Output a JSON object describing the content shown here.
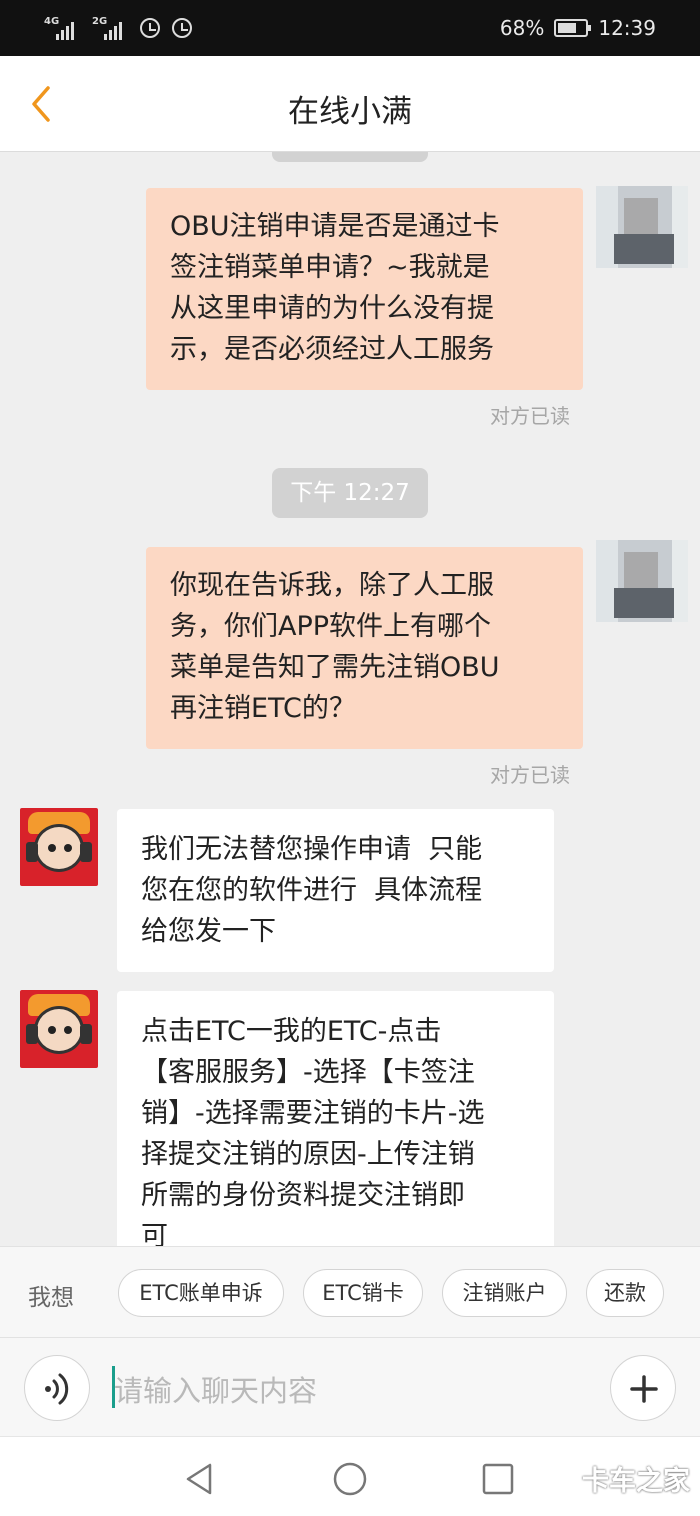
{
  "status_bar": {
    "network1": "4G",
    "network2": "2G",
    "battery": "68%",
    "battery_level": 0.68,
    "time": "12:39"
  },
  "header": {
    "title": "在线小满",
    "back_icon": "chevron-left-icon",
    "accent_color": "#f0961d"
  },
  "chat": {
    "messages": [
      {
        "side": "out",
        "lines": [
          "OBU注销申请是否是通过卡",
          "签注销菜单申请？~我就是",
          "从这里申请的为什么没有提",
          "示，是否必须经过人工服务"
        ],
        "status": "对方已读"
      },
      {
        "timestamp": "下午 12:27"
      },
      {
        "side": "out",
        "lines": [
          "你现在告诉我，除了人工服",
          "务，你们APP软件上有哪个",
          "菜单是告知了需先注销OBU",
          "再注销ETC的？"
        ],
        "status": "对方已读"
      },
      {
        "side": "in",
        "lines": [
          "我们无法替您操作申请  只能",
          "您在您的软件进行  具体流程",
          "给您发一下"
        ]
      },
      {
        "side": "in",
        "lines": [
          "点击ETC一我的ETC-点击",
          "【客服服务】-选择【卡签注",
          "销】-选择需要注销的卡片-选",
          "择提交注销的原因-上传注销",
          "所需的身份资料提交注销即",
          "可"
        ]
      }
    ]
  },
  "quick_replies": {
    "label": "我想",
    "items": [
      "ETC账单申诉",
      "ETC销卡",
      "注销账户",
      "还款"
    ]
  },
  "input_bar": {
    "placeholder": "请输入聊天内容",
    "voice_icon": "voice-icon",
    "plus_icon": "plus-icon"
  },
  "nav_bar": {
    "back_icon": "triangle-back-icon",
    "home_icon": "circle-home-icon",
    "recents_icon": "square-recents-icon",
    "watermark": "卡车之家"
  }
}
